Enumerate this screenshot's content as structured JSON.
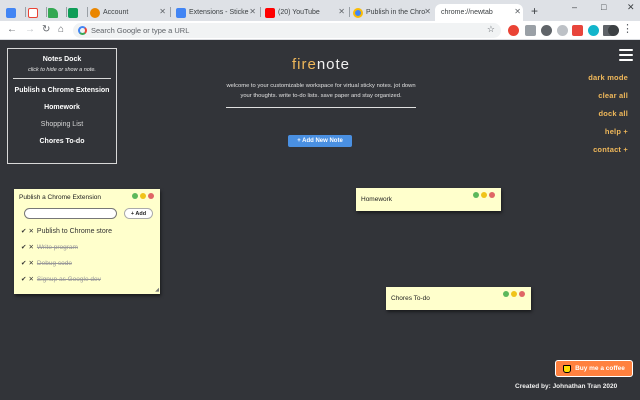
{
  "browser": {
    "tabs": [
      {
        "label": "",
        "icon": "calendar-icon",
        "color": "#4285f4"
      },
      {
        "label": "",
        "icon": "gmail-icon",
        "color": "#ea4335"
      },
      {
        "label": "",
        "icon": "drive-icon",
        "color": "#34a853"
      },
      {
        "label": "",
        "icon": "sheets-icon",
        "color": "#0f9d58"
      },
      {
        "label": "Account",
        "icon": "account-icon",
        "color": "#ea8600"
      },
      {
        "label": "Extensions - Sticke",
        "icon": "extension-icon",
        "color": "#4285f4"
      },
      {
        "label": "(20) YouTube",
        "icon": "youtube-icon",
        "color": "#ff0000"
      },
      {
        "label": "Publish in the Chro",
        "icon": "chrome-icon",
        "color": "#4285f4"
      },
      {
        "label": "chrome://newtab",
        "icon": "",
        "color": ""
      }
    ],
    "new_tab_symbol": "+",
    "window_controls": [
      "–",
      "□",
      "✕"
    ],
    "omnibox_placeholder": "Search Google or type a URL"
  },
  "page": {
    "dock": {
      "title": "Notes Dock",
      "hint": "click to hide or show a note.",
      "items": [
        {
          "label": "Publish a Chrome Extension",
          "dim": false
        },
        {
          "label": "Homework",
          "dim": false
        },
        {
          "label": "Shopping List",
          "dim": true
        },
        {
          "label": "Chores To-do",
          "dim": false
        }
      ]
    },
    "logo": {
      "part1": "fire",
      "part2": "note"
    },
    "tagline": "welcome to your customizable workspace for virtual sticky notes. jot down your thoughts. write to-do lists. save paper and stay organized.",
    "add_note_label": "+ Add New Note",
    "menu": [
      "dark mode",
      "clear all",
      "dock all",
      "help +",
      "contact +"
    ],
    "notes": [
      {
        "title": "Publish a Chrome Extension",
        "add_label": "+ Add",
        "input_value": "",
        "todos": [
          {
            "text": "Publish to Chrome store",
            "done": false
          },
          {
            "text": "Write program",
            "done": true
          },
          {
            "text": "Debug code",
            "done": true
          },
          {
            "text": "Signup as Google dev",
            "done": true
          }
        ]
      },
      {
        "title": "Homework"
      },
      {
        "title": "Chores To-do"
      }
    ],
    "coffee_label": "Buy me a coffee",
    "credit": "Created by: Johnathan Tran 2020"
  },
  "colors": {
    "background": "#323439",
    "accent": "#f0b85a",
    "button_blue": "#4a90e2",
    "note_yellow": "#ffffcc",
    "coffee_orange": "#ff813f"
  }
}
